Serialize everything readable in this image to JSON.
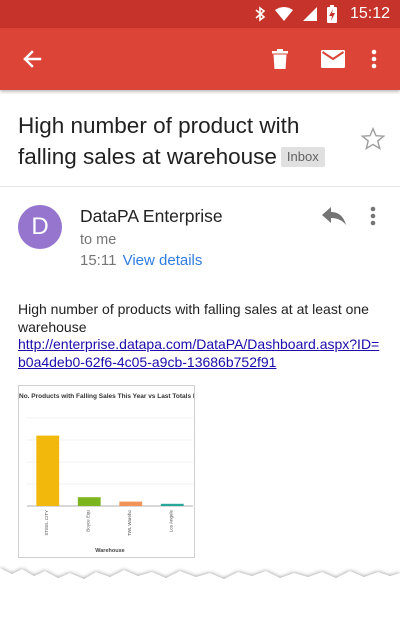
{
  "status_bar": {
    "time": "15:12",
    "icons": [
      "bluetooth-icon",
      "wifi-icon",
      "signal-icon",
      "battery-icon"
    ]
  },
  "app_bar": {
    "color": "#db4437",
    "actions": [
      "back-arrow-icon",
      "delete-icon",
      "mail-icon",
      "more-vert-icon"
    ]
  },
  "email": {
    "subject": "High number of product with falling sales at warehouse",
    "label": "Inbox",
    "sender": {
      "avatar_letter": "D",
      "avatar_color": "#9575cd",
      "name": "DataPA Enterprise",
      "recipient": "to me",
      "time": "15:11",
      "view_details": "View details"
    },
    "body": {
      "text": "High number of products with falling sales at at least one warehouse",
      "link": "http://enterprise.datapa.com/DataPA/Dashboard.aspx?ID=b0a4deb0-62f6-4c05-a9cb-13686b752f91"
    }
  },
  "chart_data": {
    "type": "bar",
    "title": "No. Products with Falling Sales This Year vs Last Totals by Warehouse",
    "xlabel": "Warehouse",
    "ylabel": "",
    "categories": [
      "STEEL CITY",
      "Boyce Equ",
      "TWL Wareho",
      "Los Angele"
    ],
    "values": [
      64,
      8,
      4,
      2
    ],
    "colors": [
      "#f2b90c",
      "#7db51e",
      "#f29458",
      "#28a89a"
    ],
    "ylim": [
      0,
      80
    ],
    "grid": true
  }
}
